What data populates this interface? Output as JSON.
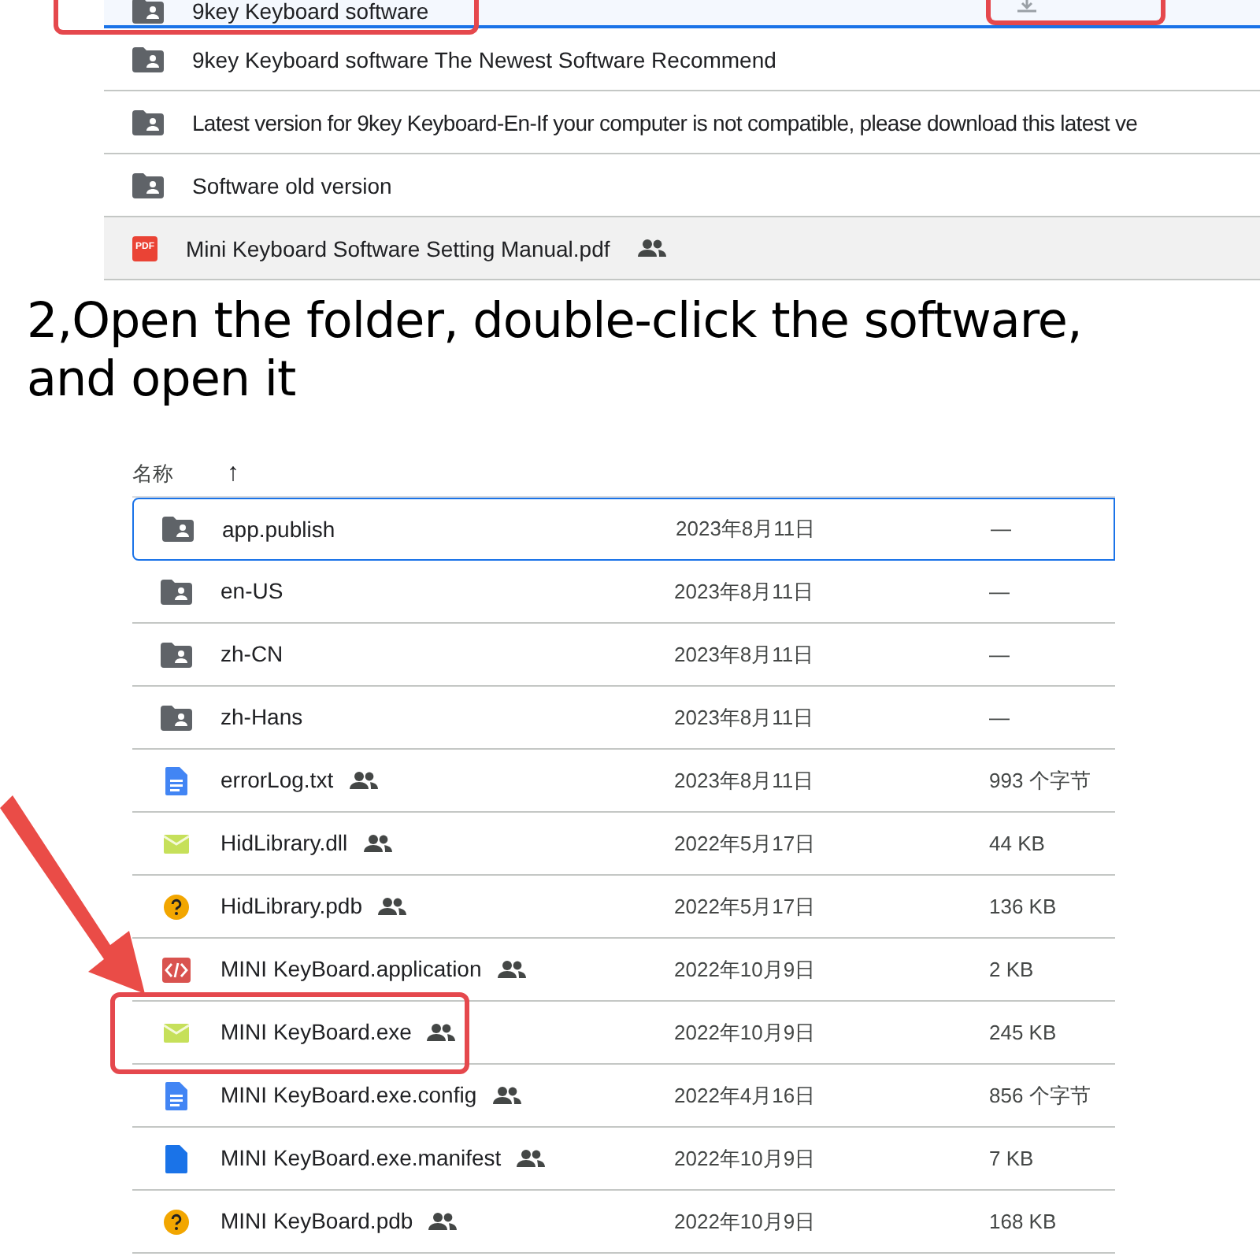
{
  "top_list": {
    "rows": [
      {
        "name": "9key Keyboard software",
        "kind": "folder",
        "shared": false,
        "selected": true,
        "highlighted": true,
        "hovered": false
      },
      {
        "name": "9key Keyboard software The Newest Software Recommend",
        "kind": "folder",
        "shared": false,
        "selected": false,
        "highlighted": false,
        "hovered": false
      },
      {
        "name": "Latest version for 9key Keyboard-En-If your computer is not compatible, please download this latest ve",
        "kind": "folder",
        "shared": false,
        "selected": false,
        "highlighted": false,
        "hovered": false
      },
      {
        "name": "Software old version",
        "kind": "folder",
        "shared": false,
        "selected": false,
        "highlighted": false,
        "hovered": false
      },
      {
        "name": "Mini Keyboard Software Setting Manual.pdf",
        "kind": "pdf",
        "shared": true,
        "selected": false,
        "highlighted": false,
        "hovered": true
      }
    ]
  },
  "pdf_label": "PDF",
  "instruction": "2,Open the folder, double-click the software, and open it",
  "file_table": {
    "header": {
      "name": "名称",
      "sort_arrow": "↑"
    },
    "rows": [
      {
        "name": "app.publish",
        "kind": "folder",
        "shared": false,
        "date": "2023年8月11日",
        "size": "—",
        "selected": true,
        "highlighted": false
      },
      {
        "name": "en-US",
        "kind": "folder",
        "shared": false,
        "date": "2023年8月11日",
        "size": "—",
        "selected": false,
        "highlighted": false
      },
      {
        "name": "zh-CN",
        "kind": "folder",
        "shared": false,
        "date": "2023年8月11日",
        "size": "—",
        "selected": false,
        "highlighted": false
      },
      {
        "name": "zh-Hans",
        "kind": "folder",
        "shared": false,
        "date": "2023年8月11日",
        "size": "—",
        "selected": false,
        "highlighted": false
      },
      {
        "name": "errorLog.txt",
        "kind": "doc",
        "shared": true,
        "date": "2023年8月11日",
        "size": "993 个字节",
        "selected": false,
        "highlighted": false
      },
      {
        "name": "HidLibrary.dll",
        "kind": "exe",
        "shared": true,
        "date": "2022年5月17日",
        "size": "44 KB",
        "selected": false,
        "highlighted": false
      },
      {
        "name": "HidLibrary.pdb",
        "kind": "unknown",
        "shared": true,
        "date": "2022年5月17日",
        "size": "136 KB",
        "selected": false,
        "highlighted": false
      },
      {
        "name": "MINI KeyBoard.application",
        "kind": "code",
        "shared": true,
        "date": "2022年10月9日",
        "size": "2 KB",
        "selected": false,
        "highlighted": false
      },
      {
        "name": "MINI KeyBoard.exe",
        "kind": "exe",
        "shared": true,
        "date": "2022年10月9日",
        "size": "245 KB",
        "selected": false,
        "highlighted": true
      },
      {
        "name": "MINI KeyBoard.exe.config",
        "kind": "doc",
        "shared": true,
        "date": "2022年4月16日",
        "size": "856 个字节",
        "selected": false,
        "highlighted": false
      },
      {
        "name": "MINI KeyBoard.exe.manifest",
        "kind": "file",
        "shared": true,
        "date": "2022年10月9日",
        "size": "7 KB",
        "selected": false,
        "highlighted": false
      },
      {
        "name": "MINI KeyBoard.pdb",
        "kind": "unknown",
        "shared": true,
        "date": "2022年10月9日",
        "size": "168 KB",
        "selected": false,
        "highlighted": false
      }
    ]
  }
}
